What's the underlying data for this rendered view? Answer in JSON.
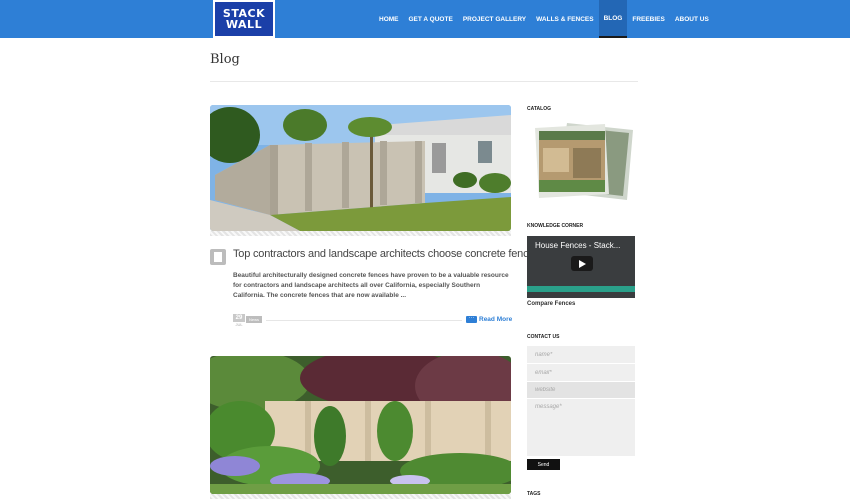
{
  "header": {
    "logo_line1": "STACK",
    "logo_line2": "WALL",
    "nav": [
      "HOME",
      "GET A QUOTE",
      "PROJECT GALLERY",
      "WALLS & FENCES",
      "BLOG",
      "FREEBIES",
      "ABOUT US"
    ],
    "active_nav": "BLOG"
  },
  "page": {
    "title": "Blog"
  },
  "post": {
    "title": "Top contractors and landscape architects choose concrete fences.",
    "excerpt": "Beautiful architecturally designed concrete fences have proven to be a valuable resource for contractors and landscape architects all over California, especially Southern California. The concrete fences that are now available ...",
    "date_day": "29",
    "date_month": "JUL",
    "tag": "News",
    "read_more": "Read More"
  },
  "sidebar": {
    "catalog_heading": "CATALOG",
    "knowledge_heading": "KNOWLEDGE CORNER",
    "video_title": "House Fences - Stack...",
    "compare_link": "Compare Fences",
    "contact_heading": "CONTACT US",
    "name_placeholder": "name*",
    "email_placeholder": "email*",
    "website_placeholder": "website",
    "message_placeholder": "message*",
    "send_label": "Send",
    "tags_heading": "TAGS"
  },
  "colors": {
    "header_blue": "#2e7fd6",
    "logo_blue": "#1b3fa8",
    "link_blue": "#2e7fd6"
  }
}
